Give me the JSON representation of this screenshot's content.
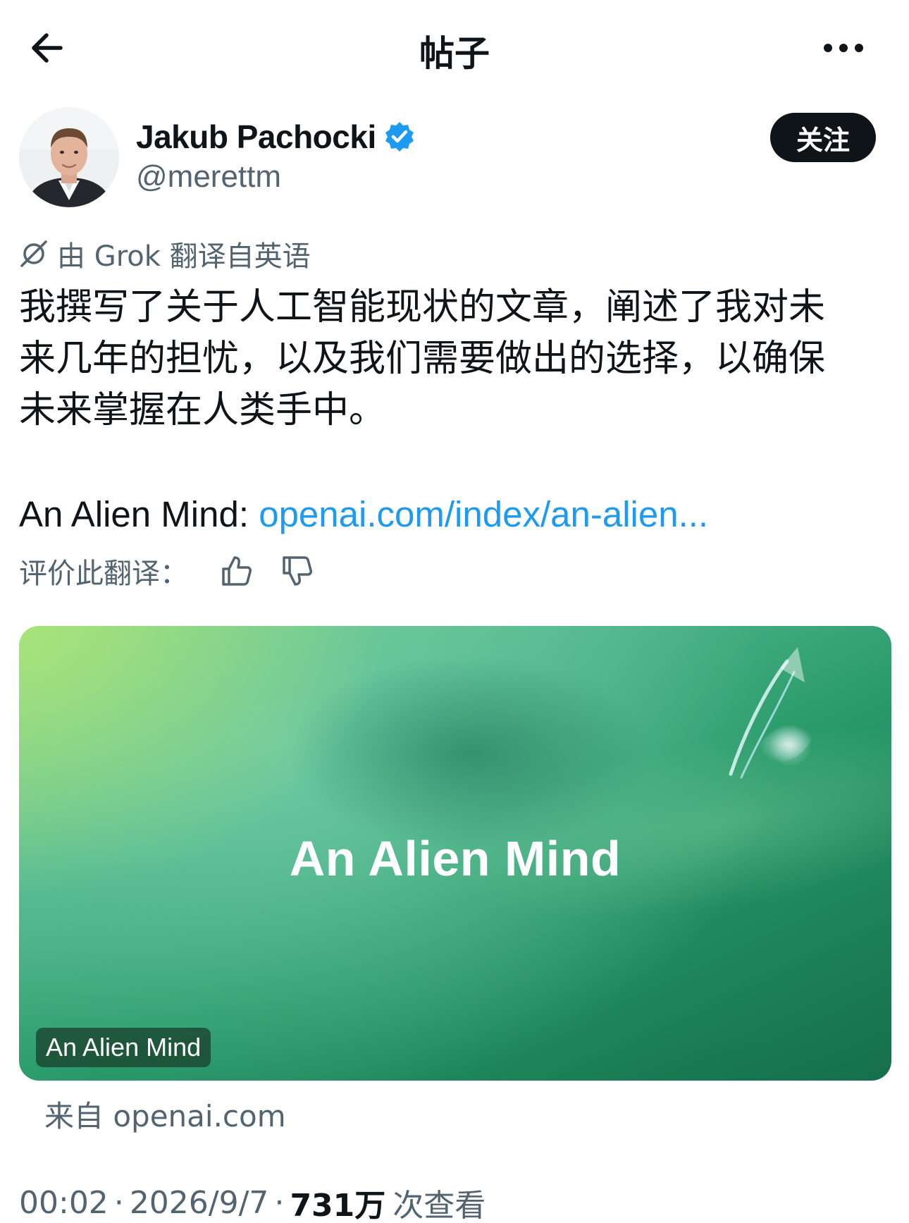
{
  "header": {
    "title": "帖子"
  },
  "author": {
    "display_name": "Jakub Pachocki",
    "handle": "@merettm",
    "follow_label": "关注"
  },
  "translation": {
    "notice": "由 Grok 翻译自英语",
    "rate_label": "评价此翻译："
  },
  "post": {
    "lines": [
      "我撰写了关于人工智能现状的文章，阐述了我对未",
      "来几年的担忧，以及我们需要做出的选择，以确保",
      "未来掌握在人类手中。"
    ],
    "link_prefix": "An Alien Mind: ",
    "link_text": "openai.com/index/an-alien..."
  },
  "card": {
    "title": "An Alien Mind",
    "badge": "An Alien Mind",
    "source": "来自 openai.com"
  },
  "meta": {
    "time": "00:02",
    "date": "2026/9/7",
    "views": "731万",
    "views_label": "次查看"
  },
  "colors": {
    "text": "#0f1419",
    "secondary": "#536471",
    "link": "#1d9bf0",
    "verified": "#1d9bf0",
    "follow_bg": "#0f1419"
  }
}
